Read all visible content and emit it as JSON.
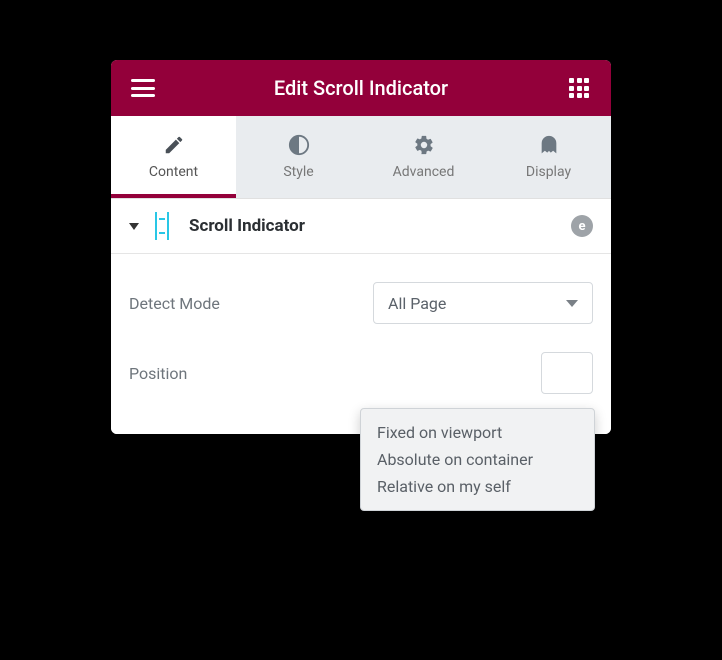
{
  "header": {
    "title": "Edit Scroll Indicator"
  },
  "tabs": [
    {
      "label": "Content"
    },
    {
      "label": "Style"
    },
    {
      "label": "Advanced"
    },
    {
      "label": "Display"
    }
  ],
  "section": {
    "title": "Scroll Indicator"
  },
  "controls": {
    "detect_mode": {
      "label": "Detect Mode",
      "value": "All Page"
    },
    "position": {
      "label": "Position",
      "options": [
        "Fixed on viewport",
        "Absolute on container",
        "Relative on my self"
      ]
    }
  }
}
